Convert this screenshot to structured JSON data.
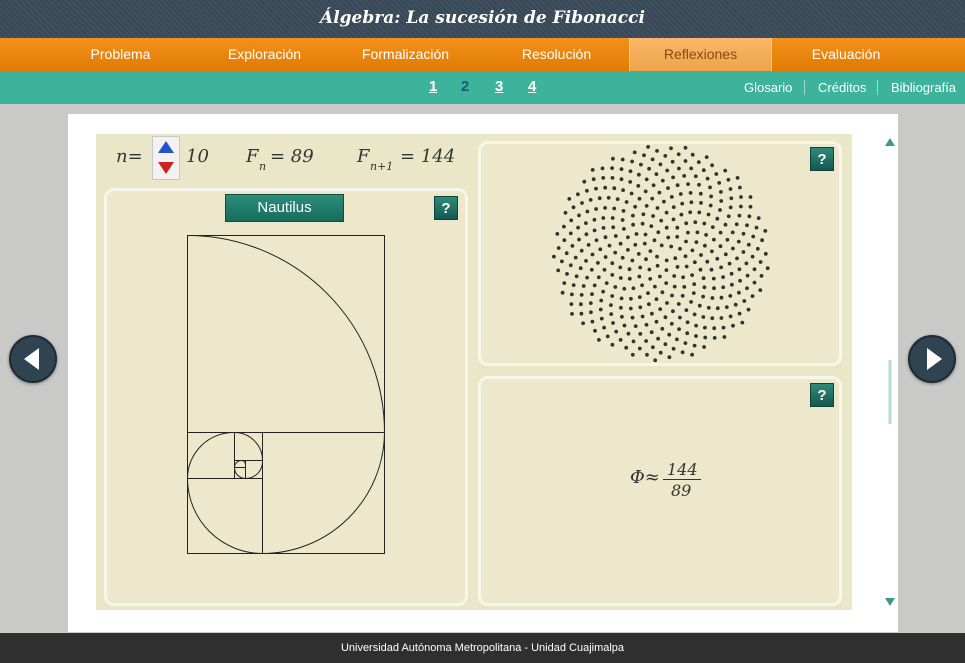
{
  "header": {
    "title": "Álgebra: La sucesión de Fibonacci"
  },
  "main_nav": {
    "tabs": [
      {
        "label": "Problema"
      },
      {
        "label": "Exploración"
      },
      {
        "label": "Formalización"
      },
      {
        "label": "Resolución"
      },
      {
        "label": "Reflexiones",
        "active": true
      },
      {
        "label": "Evaluación"
      }
    ]
  },
  "sub_nav": {
    "pages": [
      "1",
      "2",
      "3",
      "4"
    ],
    "current_page": "2",
    "links": [
      "Glosario",
      "Créditos",
      "Bibliografía"
    ]
  },
  "controls": {
    "n_label": "n=",
    "n_value": "10",
    "fn_label": "F",
    "fn_sub": "n",
    "fn_value": "= 89",
    "fn1_label": "F",
    "fn1_sub": "n+1",
    "fn1_value": "= 144"
  },
  "nautilus_panel": {
    "button_label": "Nautilus",
    "help_label": "?"
  },
  "sunflower_panel": {
    "help_label": "?"
  },
  "ratio_panel": {
    "help_label": "?",
    "phi_label": "Φ≈",
    "numerator": "144",
    "denominator": "89"
  },
  "footer": {
    "text": "Universidad Autónoma Metropolitana - Unidad Cuajimalpa"
  },
  "colors": {
    "orange_nav": "#e88a0e",
    "teal_nav": "#3cb39a",
    "dark_header": "#3a4a5a",
    "button_teal": "#1f7a6a",
    "spinner_up": "#2255cc",
    "spinner_down": "#cc2222"
  },
  "icons": {
    "prev": "left-triangle-arrow-icon",
    "next": "right-triangle-arrow-icon",
    "spinner_up": "triangle-up-icon",
    "spinner_down": "triangle-down-icon"
  }
}
